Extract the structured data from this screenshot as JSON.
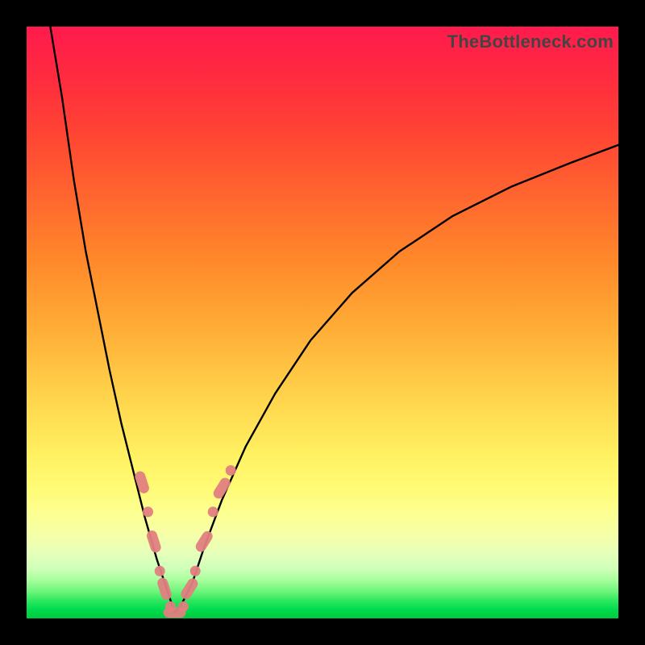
{
  "watermark": "TheBottleneck.com",
  "colors": {
    "background": "#000000",
    "curve": "#000000",
    "markers": "#e08080",
    "gradient_top": "#ff1a4d",
    "gradient_bottom": "#00c93e"
  },
  "chart_data": {
    "type": "line",
    "title": "",
    "xlabel": "",
    "ylabel": "",
    "xlim": [
      0,
      100
    ],
    "ylim": [
      0,
      100
    ],
    "grid": false,
    "legend": false,
    "note": "No axis tick labels or numeric annotations are rendered. Values are estimated from geometry; the curve resembles |log(x / x0)|-style asymmetric V reaching y≈0 near x≈25.",
    "series": [
      {
        "name": "curve",
        "x": [
          4,
          6,
          8,
          10,
          12,
          14,
          16,
          18,
          20,
          22,
          24,
          25,
          26,
          28,
          30,
          33,
          37,
          42,
          48,
          55,
          63,
          72,
          82,
          92,
          100
        ],
        "y": [
          100,
          88,
          74,
          62,
          52,
          42,
          33,
          25,
          17,
          10,
          4,
          1,
          2,
          6,
          12,
          20,
          29,
          38,
          47,
          55,
          62,
          68,
          73,
          77,
          80
        ]
      }
    ],
    "markers": [
      {
        "x": 19.5,
        "y": 23,
        "shape": "pill",
        "orientation": "vertical"
      },
      {
        "x": 20.5,
        "y": 18,
        "shape": "dot"
      },
      {
        "x": 21.5,
        "y": 13,
        "shape": "pill",
        "orientation": "vertical"
      },
      {
        "x": 22.5,
        "y": 8,
        "shape": "dot"
      },
      {
        "x": 23.3,
        "y": 5,
        "shape": "pill",
        "orientation": "vertical"
      },
      {
        "x": 24.3,
        "y": 2,
        "shape": "dot"
      },
      {
        "x": 25.0,
        "y": 1,
        "shape": "pill",
        "orientation": "horizontal"
      },
      {
        "x": 26.5,
        "y": 2,
        "shape": "dot"
      },
      {
        "x": 27.5,
        "y": 5,
        "shape": "pill",
        "orientation": "diag"
      },
      {
        "x": 28.5,
        "y": 8,
        "shape": "dot"
      },
      {
        "x": 30.0,
        "y": 13,
        "shape": "pill",
        "orientation": "diag"
      },
      {
        "x": 31.5,
        "y": 18,
        "shape": "dot"
      },
      {
        "x": 33.0,
        "y": 22,
        "shape": "pill",
        "orientation": "diag"
      },
      {
        "x": 34.5,
        "y": 25,
        "shape": "dot"
      }
    ]
  }
}
